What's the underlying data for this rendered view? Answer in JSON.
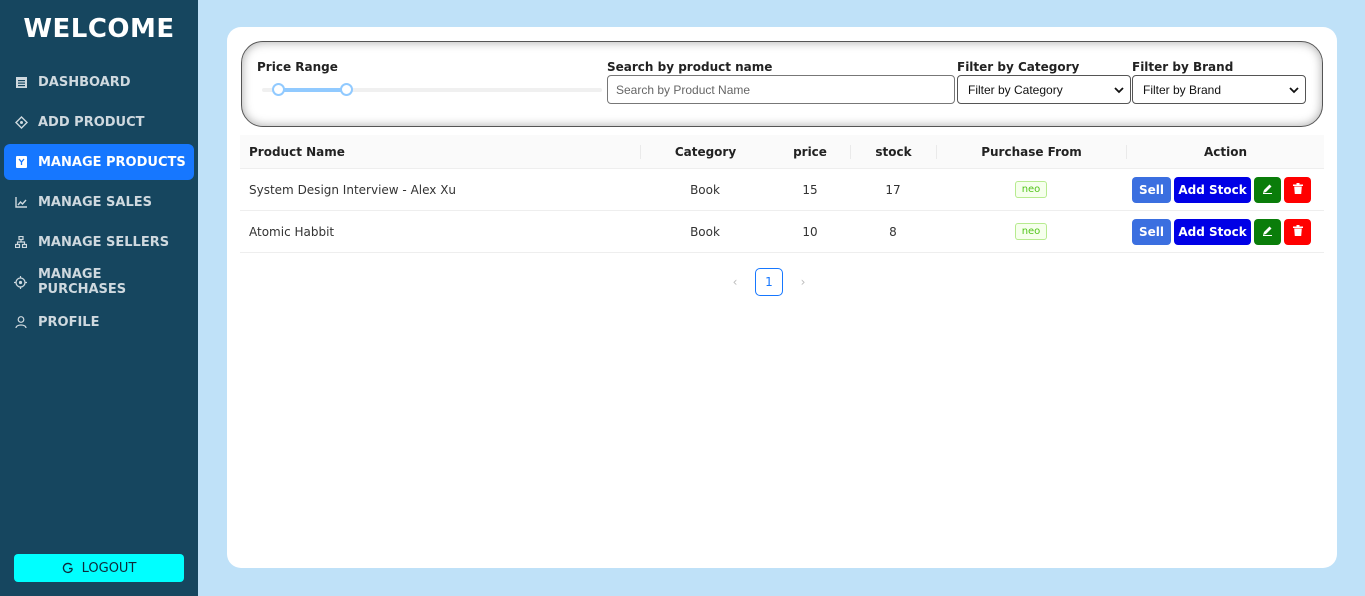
{
  "sidebar": {
    "title": "WELCOME",
    "items": [
      {
        "label": "DASHBOARD",
        "icon": "dashboard-icon"
      },
      {
        "label": "ADD PRODUCT",
        "icon": "add-product-icon"
      },
      {
        "label": "MANAGE PRODUCTS",
        "icon": "products-icon"
      },
      {
        "label": "MANAGE SALES",
        "icon": "chart-icon"
      },
      {
        "label": "MANAGE SELLERS",
        "icon": "sellers-icon"
      },
      {
        "label": "MANAGE PURCHASES",
        "icon": "purchases-icon"
      },
      {
        "label": "PROFILE",
        "icon": "user-icon"
      }
    ],
    "active_item": "MANAGE PRODUCTS",
    "logout_label": "LOGOUT"
  },
  "filters": {
    "price_range_label": "Price Range",
    "price_range_low": 0,
    "price_range_high": 0.2,
    "search_label": "Search by product name",
    "search_placeholder": "Search by Product Name",
    "category_label": "Filter by Category",
    "category_selected": "Filter by Category",
    "brand_label": "Filter by Brand",
    "brand_selected": "Filter by Brand"
  },
  "table": {
    "headers": [
      "Product Name",
      "Category",
      "price",
      "stock",
      "Purchase From",
      "Action"
    ],
    "rows": [
      {
        "name": "System Design Interview - Alex Xu",
        "category": "Book",
        "price": "15",
        "stock": "17",
        "purchase_from": "neo"
      },
      {
        "name": "Atomic Habbit",
        "category": "Book",
        "price": "10",
        "stock": "8",
        "purchase_from": "neo"
      }
    ],
    "action_labels": {
      "sell": "Sell",
      "add_stock": "Add Stock"
    }
  },
  "pagination": {
    "current": "1",
    "prev": "‹",
    "next": "›"
  },
  "colors": {
    "sidebar": "#16465f",
    "active": "#1677ff",
    "logout": "#00ffff",
    "background": "#bfe1f8"
  }
}
